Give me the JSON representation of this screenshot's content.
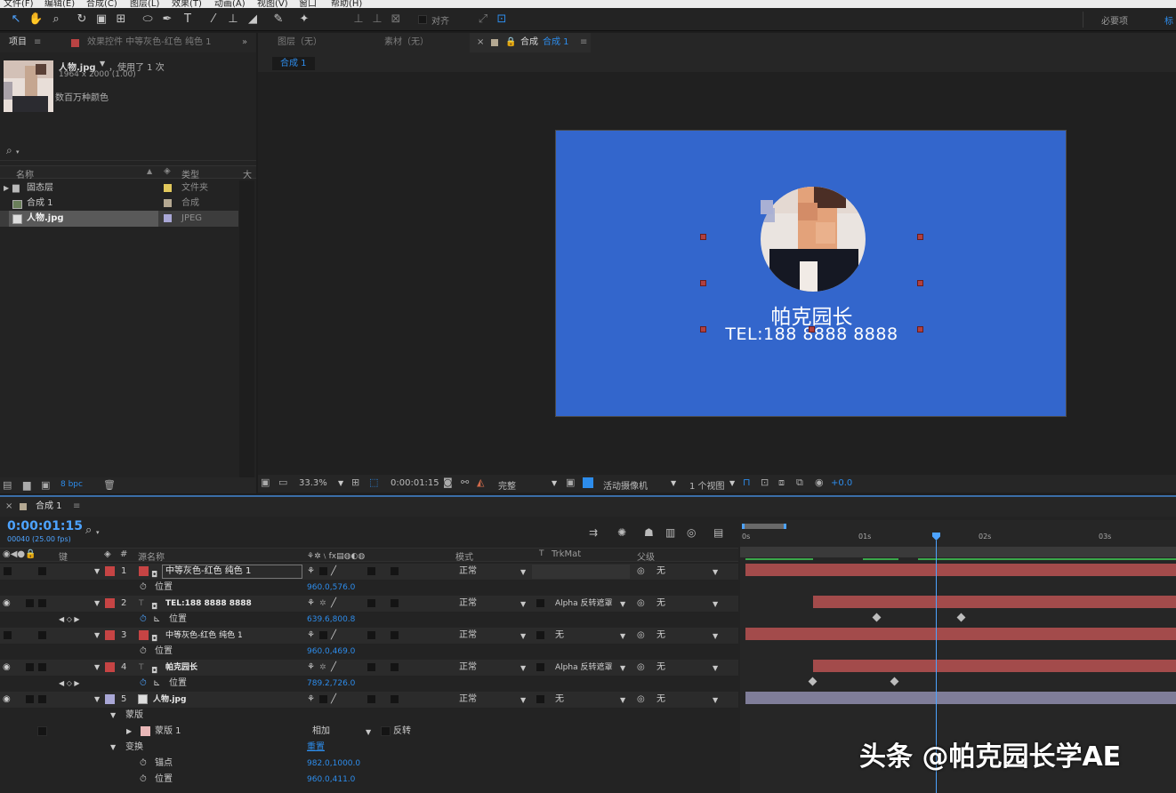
{
  "menu": [
    "文件(F)",
    "编辑(E)",
    "合成(C)",
    "图层(L)",
    "效果(T)",
    "动画(A)",
    "视图(V)",
    "窗口",
    "帮助(H)"
  ],
  "toolbar": {
    "snap_label": "对齐",
    "workspace": "必要项",
    "workspace2": "标"
  },
  "project": {
    "tab_label": "项目",
    "effects_tab": "效果控件 中等灰色-红色 纯色 1",
    "asset_name": "人物.jpg",
    "asset_used": "，使用了 1 次",
    "asset_dims": "1964 x 2000 (1.00)",
    "asset_colors": "数百万种颜色",
    "col_name": "名称",
    "col_type": "类型",
    "col_size": "大",
    "items": [
      {
        "name": "固态层",
        "type": "文件夹"
      },
      {
        "name": "合成 1",
        "type": "合成"
      },
      {
        "name": "人物.jpg",
        "type": "JPEG"
      }
    ],
    "bpc": "8 bpc"
  },
  "viewer": {
    "tab_layer": "图层（无）",
    "tab_footage": "素材（无）",
    "tab_comp": "合成",
    "tab_comp_name": "合成 1",
    "breadcrumb": "合成 1",
    "comp_title": "帕克园长",
    "comp_tel": "TEL:188 8888 8888",
    "bg_color": "#3366cc",
    "zoom": "33.3%",
    "timecode": "0:00:01:15",
    "resolution": "完整",
    "camera": "活动摄像机",
    "views": "1 个视图",
    "exposure": "+0.0"
  },
  "timeline": {
    "tab_label": "合成 1",
    "timecode": "0:00:01:15",
    "frames": "00040 (25.00 fps)",
    "cols": {
      "key": "键",
      "src": "源名称",
      "mode": "模式",
      "t": "T",
      "trkmat": "TrkMat",
      "parent": "父级"
    },
    "ruler": [
      "0s",
      "01s",
      "02s",
      "03s"
    ],
    "layers": [
      {
        "num": "1",
        "name": "中等灰色-红色 纯色 1",
        "mode": "正常",
        "trk": "",
        "parent": "无",
        "prop": "位置",
        "value": "960.0,576.0"
      },
      {
        "num": "2",
        "name": "TEL:188 8888 8888",
        "mode": "正常",
        "trk": "Alpha 反转遮罩",
        "parent": "无",
        "prop": "位置",
        "value": "639.6,800.8"
      },
      {
        "num": "3",
        "name": "中等灰色-红色 纯色 1",
        "mode": "正常",
        "trk": "无",
        "parent": "无",
        "prop": "位置",
        "value": "960.0,469.0"
      },
      {
        "num": "4",
        "name": "帕克园长",
        "mode": "正常",
        "trk": "Alpha 反转遮罩",
        "parent": "无",
        "prop": "位置",
        "value": "789.2,726.0"
      },
      {
        "num": "5",
        "name": "人物.jpg",
        "mode": "正常",
        "trk": "无",
        "parent": "无"
      }
    ],
    "mask_group": "蒙版",
    "mask_name": "蒙版 1",
    "mask_mode": "相加",
    "mask_invert": "反转",
    "transform": "变换",
    "reset": "重置",
    "anchor_label": "锚点",
    "anchor_value": "982.0,1000.0",
    "pos_label": "位置",
    "pos_value": "960.0,411.0"
  },
  "watermark": "头条 @帕克园长学AE"
}
